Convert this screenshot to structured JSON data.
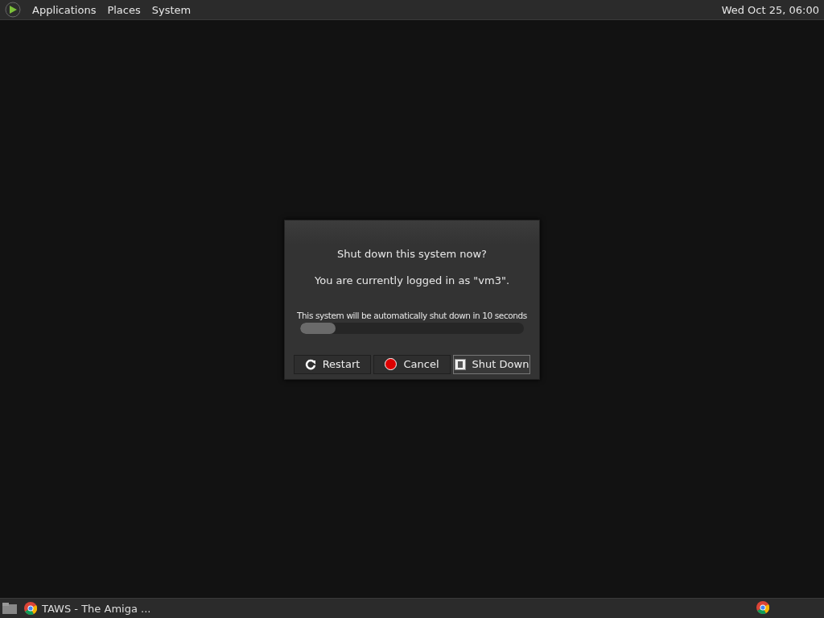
{
  "top_panel": {
    "menus": [
      "Applications",
      "Places",
      "System"
    ],
    "clock": "Wed Oct 25, 06:00"
  },
  "dialog": {
    "question": "Shut down this system now?",
    "logged_in": "You are currently logged in as \"vm3\".",
    "countdown": "This system will be automatically shut down in 10 seconds",
    "progress": {
      "level": 0.16
    },
    "buttons": [
      {
        "kind": "restart",
        "label": "Restart",
        "selected": false
      },
      {
        "kind": "cancel",
        "label": "Cancel",
        "selected": false
      },
      {
        "kind": "shutdown",
        "label": "Shut Down",
        "selected": true
      }
    ]
  },
  "taskbar": {
    "tasks": [
      {
        "label": "TAWS - The Amiga ..."
      }
    ]
  }
}
